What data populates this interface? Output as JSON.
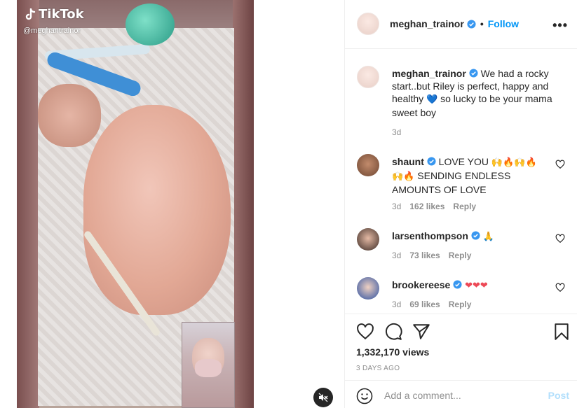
{
  "media": {
    "tiktok_label": "TikTok",
    "tiktok_handle": "@meghantrainor",
    "mute_icon": "muted-speaker-icon"
  },
  "header": {
    "username": "meghan_trainor",
    "separator": "•",
    "follow_label": "Follow",
    "more_icon": "more-options-icon",
    "more_glyph": "•••"
  },
  "caption": {
    "username": "meghan_trainor",
    "text_before_heart": "We had a rocky start..but Riley is perfect, happy and healthy",
    "heart": "💙",
    "text_after_heart": "so lucky to be your mama sweet boy",
    "age": "3d"
  },
  "comments": [
    {
      "username": "shaunt",
      "text": "LOVE YOU",
      "emoji_1": "🙌🔥🙌🔥",
      "emoji_2": "🙌🔥",
      "text_2": "SENDING ENDLESS AMOUNTS OF LOVE",
      "age": "3d",
      "likes": "162 likes",
      "reply": "Reply"
    },
    {
      "username": "larsenthompson",
      "text": "",
      "emoji_1": "🙏",
      "age": "3d",
      "likes": "73 likes",
      "reply": "Reply"
    },
    {
      "username": "brookereese",
      "text": "",
      "emoji_1": "❤❤❤",
      "age": "3d",
      "likes": "69 likes",
      "reply": "Reply"
    }
  ],
  "actions": {
    "views": "1,332,170 views",
    "time": "3 DAYS AGO"
  },
  "add_comment": {
    "placeholder": "Add a comment...",
    "post_label": "Post"
  },
  "colors": {
    "link_blue": "#0095f6",
    "muted_text": "#8e8e8e",
    "post_disabled": "#b2dffc"
  }
}
